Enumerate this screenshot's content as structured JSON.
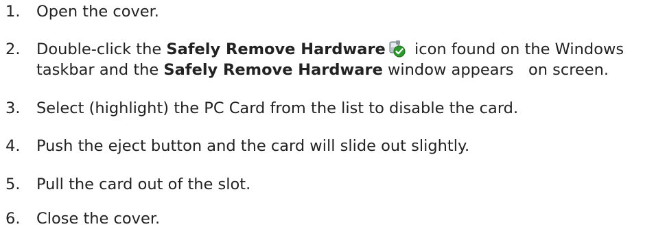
{
  "steps": [
    {
      "number": "1.",
      "text": "Open the cover."
    },
    {
      "number": "2.",
      "part1": "Double-click the ",
      "bold1": "Safely Remove Hardware",
      "icon": "safely-remove-hardware-icon",
      "part2": " icon found on the Windows",
      "part3": "taskbar and the ",
      "bold2": "Safely Remove Hardware",
      "part4": " window appears   on screen."
    },
    {
      "number": "3.",
      "text": "Select (highlight) the PC Card from the list to disable the card."
    },
    {
      "number": "4.",
      "text": "Push the eject button and the card will slide out slightly."
    },
    {
      "number": "5.",
      "text": "Pull the card out of the slot."
    },
    {
      "number": "6.",
      "text": "Close the cover."
    }
  ]
}
